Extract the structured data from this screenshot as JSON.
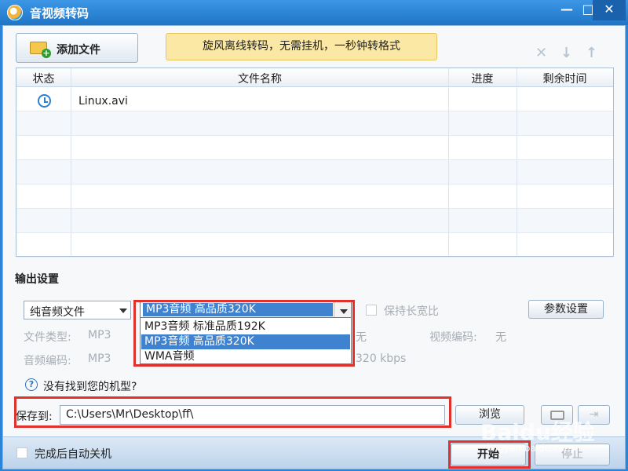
{
  "window": {
    "title": "音视频转码",
    "min_icon": "—",
    "max_icon": "□",
    "close_icon": "✕"
  },
  "toolbar": {
    "add_file_label": "添加文件",
    "banner_text": "旋风离线转码，无需挂机，一秒钟转格式",
    "delete_icon": "✕",
    "move_down_icon": "↓",
    "move_up_icon": "↑"
  },
  "table": {
    "headers": [
      "状态",
      "文件名称",
      "进度",
      "剩余时间"
    ],
    "rows": [
      {
        "file_name": "Linux.avi",
        "progress": "",
        "remaining": ""
      }
    ]
  },
  "output": {
    "section_title": "输出设置",
    "category_value": "纯音频文件",
    "format_selected": "MP3音频 高品质320K",
    "format_options": [
      "MP3音频 标准品质192K",
      "MP3音频 高品质320K",
      "WMA音频"
    ],
    "keep_ratio_label": "保持长宽比",
    "param_button": "参数设置",
    "file_type_label": "文件类型:",
    "file_type_value": "MP3",
    "audio_codec_label": "音频编码:",
    "audio_codec_value": "MP3",
    "video_codec_label": "视频编码:",
    "video_codec_value": "无",
    "resolution_value": "无",
    "bitrate_value": "320 kbps",
    "help_text": "没有找到您的机型?"
  },
  "save": {
    "label": "保存到:",
    "path": "C:\\Users\\Mr\\Desktop\\ff\\",
    "browse_label": "浏览"
  },
  "footer": {
    "shutdown_label": "完成后自动关机",
    "start_label": "开始",
    "stop_label": "停止"
  },
  "watermark": {
    "text": "Baidu经验",
    "url": "jingyan.baidu.com"
  }
}
